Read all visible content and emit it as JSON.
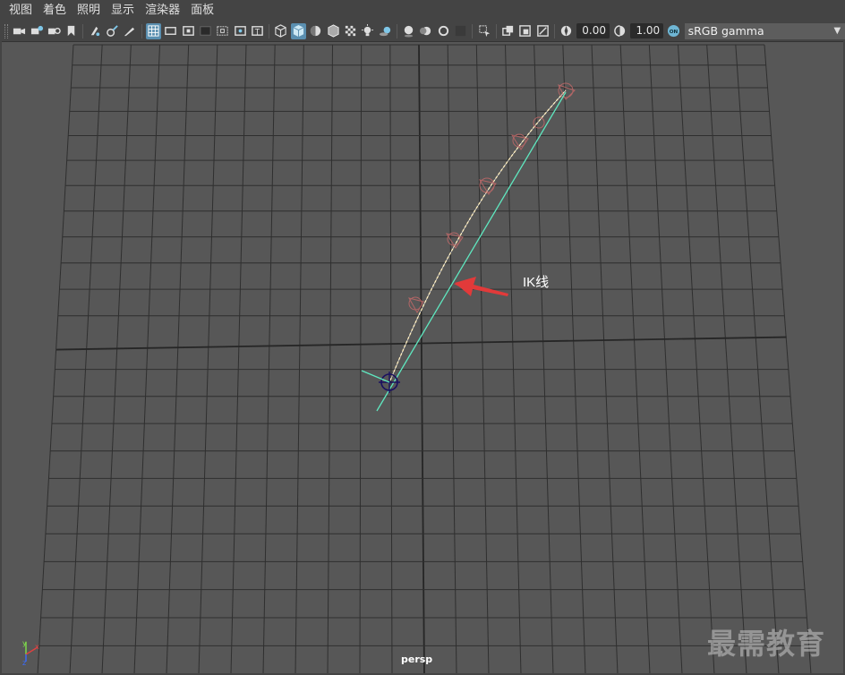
{
  "menu": {
    "items": [
      "视图",
      "着色",
      "照明",
      "显示",
      "渲染器",
      "面板"
    ]
  },
  "toolbar": {
    "exposure_value": "0.00",
    "gamma_value": "1.00",
    "color_management_badge": "ON",
    "color_space": "sRGB gamma",
    "icons": [
      "camera-icon",
      "camera-attributes-icon",
      "bookmark-icon",
      "image-plane-icon",
      "2d-pan-icon",
      "grease-pencil-icon",
      "grid-icon",
      "film-gate-icon",
      "resolution-gate-icon",
      "gate-mask-icon",
      "field-chart-icon",
      "safe-action-icon",
      "safe-title-icon",
      "wireframe-icon",
      "smooth-shade-icon",
      "default-material-icon",
      "wireframe-on-shaded-icon",
      "xray-icon",
      "use-all-lights-icon",
      "shadows-icon",
      "screen-space-ao-icon",
      "motion-blur-icon",
      "anti-aliasing-icon",
      "depth-of-field-icon",
      "isolate-select-icon",
      "xray-joints-icon",
      "xray-active-components-icon",
      "exposure-icon",
      "gamma-icon",
      "color-management-icon"
    ]
  },
  "viewport": {
    "annotation_text": "IK线",
    "camera_name": "persp",
    "axis_y": "y",
    "axis_x": "x",
    "axis_z": "z",
    "watermark": "最需教育",
    "colors": {
      "background": "#575757",
      "grid": "#2f2f2f",
      "ik_handle_line": "#5fe8c0",
      "arrow": "#e23a3a",
      "joint_chain": "#d88080"
    }
  }
}
